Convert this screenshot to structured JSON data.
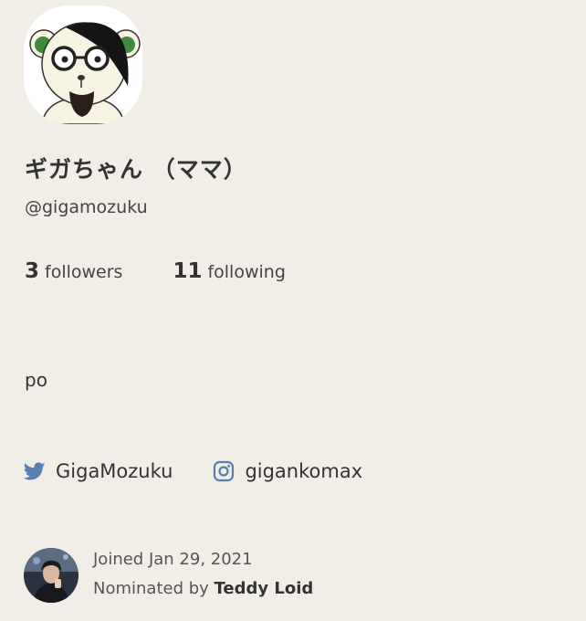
{
  "profile": {
    "avatar_icon": "bear-with-glasses-avatar",
    "name": "ギガちゃん （ママ）",
    "handle": "@gigamozuku",
    "followers": {
      "count": "3",
      "label": "followers"
    },
    "following": {
      "count": "11",
      "label": "following"
    },
    "bio": "po",
    "socials": {
      "twitter": {
        "icon": "twitter-bird-icon",
        "label": "GigaMozuku"
      },
      "instagram": {
        "icon": "instagram-icon",
        "label": "gigankomax"
      }
    },
    "joined": {
      "text": "Joined Jan 29, 2021",
      "nominated_prefix": "Nominated by",
      "nominator_name": "Teddy Loid",
      "nominator_avatar_icon": "nominator-avatar-photo"
    }
  },
  "colors": {
    "background": "#f1eee7",
    "text_primary": "#333333",
    "text_secondary": "#555555",
    "icon_blue": "#5a7fae"
  }
}
